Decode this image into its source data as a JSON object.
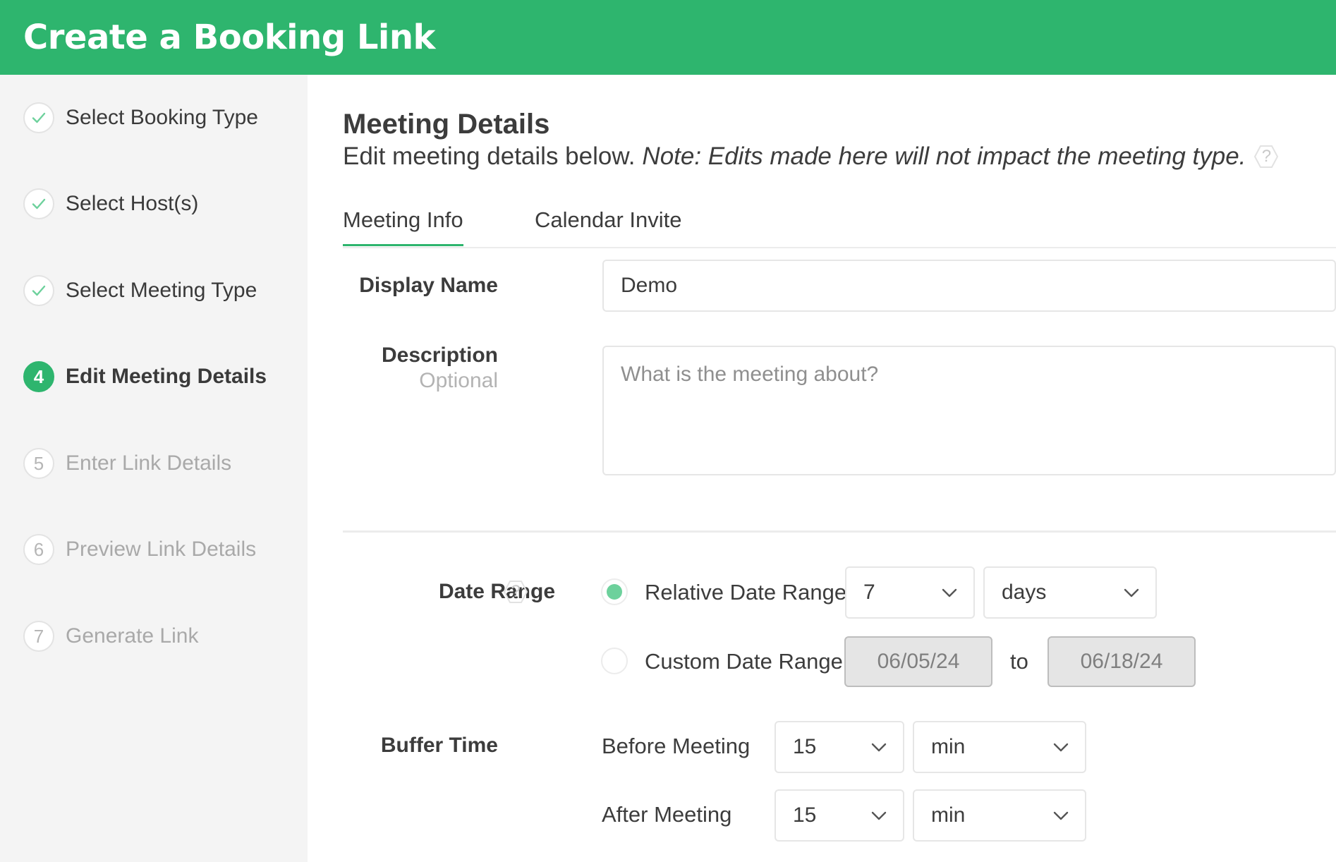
{
  "header": {
    "title": "Create a Booking Link"
  },
  "steps": [
    {
      "label": "Select Booking Type",
      "marker": "",
      "state": "done"
    },
    {
      "label": "Select Host(s)",
      "marker": "",
      "state": "done"
    },
    {
      "label": "Select Meeting Type",
      "marker": "",
      "state": "done"
    },
    {
      "label": "Edit Meeting Details",
      "marker": "4",
      "state": "active"
    },
    {
      "label": "Enter Link Details",
      "marker": "5",
      "state": "pending"
    },
    {
      "label": "Preview Link Details",
      "marker": "6",
      "state": "pending"
    },
    {
      "label": "Generate Link",
      "marker": "7",
      "state": "pending"
    }
  ],
  "main": {
    "title": "Meeting Details",
    "subtitle": "Edit meeting details below.",
    "note": "Note: Edits made here will not impact the meeting type.",
    "help": "?",
    "tabs": [
      "Meeting Info",
      "Calendar Invite"
    ],
    "display_name": {
      "label": "Display Name",
      "value": "Demo"
    },
    "description": {
      "label": "Description",
      "sublabel": "Optional",
      "placeholder": "What is the meeting about?"
    },
    "date_range": {
      "label": "Date Range",
      "help": "?",
      "relative": {
        "label": "Relative Date Range",
        "selected": true,
        "amount": "7",
        "unit": "days"
      },
      "custom": {
        "label": "Custom Date Range",
        "selected": false,
        "start": "06/05/24",
        "to": "to",
        "end": "06/18/24"
      }
    },
    "buffer_time": {
      "label": "Buffer Time",
      "before": {
        "label": "Before Meeting",
        "amount": "15",
        "unit": "min"
      },
      "after": {
        "label": "After Meeting",
        "amount": "15",
        "unit": "min"
      }
    }
  },
  "colors": {
    "brand": "#2eb56e",
    "radio_selected": "#6dd19c"
  }
}
